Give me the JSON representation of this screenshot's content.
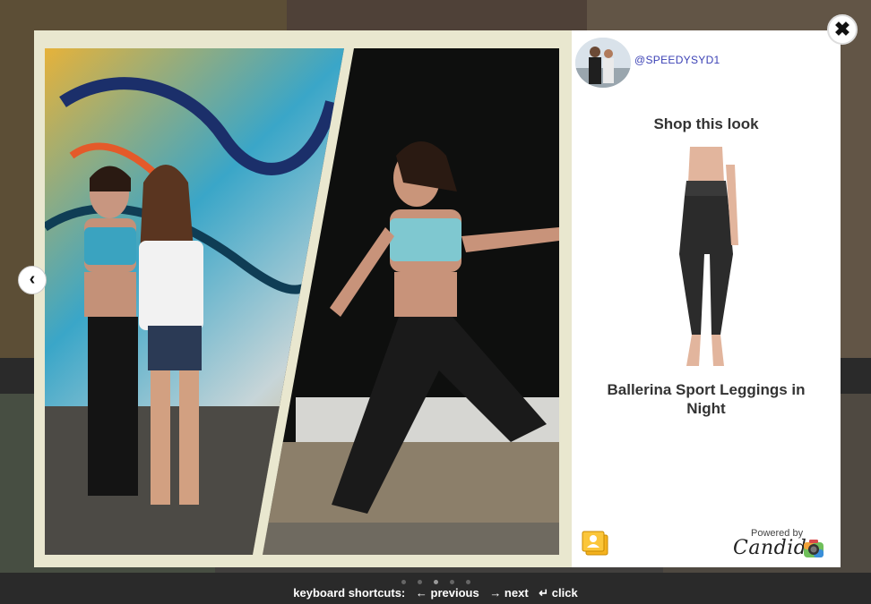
{
  "lightbox": {
    "username": "@SPEEDYSYD1",
    "shop_title": "Shop this look",
    "product_name": "Ballerina Sport Leggings in Night",
    "powered_by": "Powered by",
    "brand": "Candid",
    "close_symbol": "✖",
    "prev_symbol": "‹"
  },
  "shortcuts": {
    "label": "keyboard shortcuts:",
    "previous": "← previous",
    "next": "→ next",
    "click": "↵ click"
  },
  "pagination": {
    "count": 5,
    "active_index": 2
  },
  "icons": [
    "close-icon",
    "chevron-left-icon",
    "gallery-icon",
    "camera-icon"
  ],
  "colors": {
    "username": "#3b41b5",
    "frame": "#e9e7cf",
    "text": "#333333"
  }
}
